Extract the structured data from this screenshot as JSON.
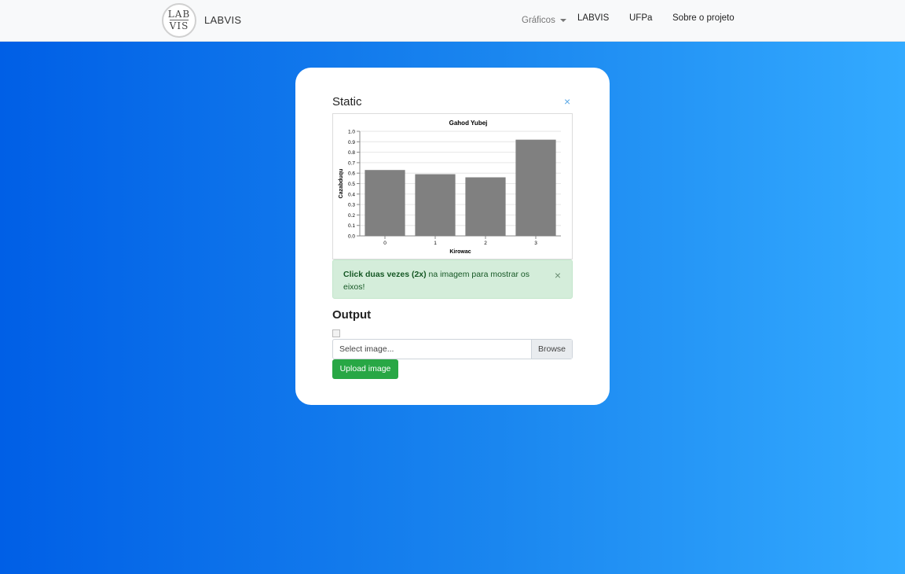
{
  "navbar": {
    "logo_line1": "LAB",
    "logo_line2": "VIS",
    "brand": "LABVIS",
    "links": {
      "graficos": "Gráficos",
      "labvis": "LABVIS",
      "ufpa": "UFPa",
      "sobre": "Sobre o projeto"
    }
  },
  "card": {
    "static_heading": "Static",
    "close_symbol": "×",
    "alert": {
      "bold": "Click duas vezes (2x)",
      "rest": " na imagem para mostrar os eixos!",
      "close_symbol": "×"
    },
    "output_heading": "Output",
    "file_placeholder": "Select image...",
    "browse_label": "Browse",
    "upload_label": "Upload image"
  },
  "colors": {
    "bar": "#808080",
    "upload_button": "#28a745",
    "alert_bg": "#d4edda"
  },
  "chart_data": {
    "type": "bar",
    "title": "Gahod Yubej",
    "xlabel": "Kirowac",
    "ylabel": "Cazabduqu",
    "categories": [
      "0",
      "1",
      "2",
      "3"
    ],
    "values": [
      0.63,
      0.59,
      0.56,
      0.92
    ],
    "ylim": [
      0,
      1.0
    ],
    "yticks": [
      0.0,
      0.1,
      0.2,
      0.3,
      0.4,
      0.5,
      0.6,
      0.7,
      0.8,
      0.9,
      1.0
    ],
    "grid": true
  }
}
